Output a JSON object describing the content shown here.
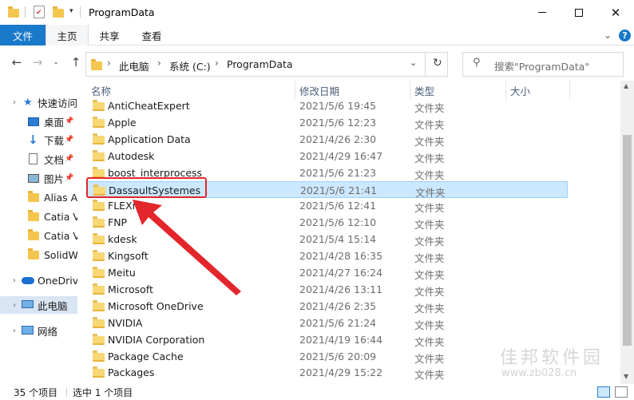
{
  "window": {
    "title": "ProgramData"
  },
  "ribbon": {
    "tabs": [
      {
        "label": "文件"
      },
      {
        "label": "主页"
      },
      {
        "label": "共享"
      },
      {
        "label": "查看"
      }
    ]
  },
  "address": {
    "crumbs": [
      "此电脑",
      "系统 (C:)",
      "ProgramData"
    ],
    "search_placeholder": "搜索\"ProgramData\""
  },
  "nav_pane": {
    "items": [
      {
        "label": "快速访问",
        "icon": "star-icon"
      },
      {
        "label": "桌面",
        "icon": "desktop-icon"
      },
      {
        "label": "下载",
        "icon": "download-icon"
      },
      {
        "label": "文档",
        "icon": "document-icon"
      },
      {
        "label": "图片",
        "icon": "pictures-icon"
      },
      {
        "label": "Alias A",
        "icon": "folder-icon"
      },
      {
        "label": "Catia V",
        "icon": "folder-icon"
      },
      {
        "label": "Catia V",
        "icon": "folder-icon"
      },
      {
        "label": "SolidW",
        "icon": "folder-icon"
      },
      {
        "label": "OneDriv",
        "icon": "cloud-icon"
      },
      {
        "label": "此电脑",
        "icon": "computer-icon"
      },
      {
        "label": "网络",
        "icon": "network-icon"
      }
    ]
  },
  "columns": {
    "name": "名称",
    "date": "修改日期",
    "type": "类型",
    "size": "大小"
  },
  "files": [
    {
      "name": "AntiCheatExpert",
      "date": "2021/5/6 19:45",
      "type": "文件夹"
    },
    {
      "name": "Apple",
      "date": "2021/5/6 12:23",
      "type": "文件夹"
    },
    {
      "name": "Application Data",
      "date": "2021/4/26 2:30",
      "type": "文件夹"
    },
    {
      "name": "Autodesk",
      "date": "2021/4/29 16:47",
      "type": "文件夹"
    },
    {
      "name": "boost_interprocess",
      "date": "2021/5/6 21:23",
      "type": "文件夹"
    },
    {
      "name": "DassaultSystemes",
      "date": "2021/5/6 21:41",
      "type": "文件夹"
    },
    {
      "name": "FLEXnet",
      "date": "2021/5/6 12:41",
      "type": "文件夹"
    },
    {
      "name": "FNP",
      "date": "2021/5/6 12:10",
      "type": "文件夹"
    },
    {
      "name": "kdesk",
      "date": "2021/5/4 15:14",
      "type": "文件夹"
    },
    {
      "name": "Kingsoft",
      "date": "2021/4/28 16:35",
      "type": "文件夹"
    },
    {
      "name": "Meitu",
      "date": "2021/4/27 16:24",
      "type": "文件夹"
    },
    {
      "name": "Microsoft",
      "date": "2021/4/26 13:11",
      "type": "文件夹"
    },
    {
      "name": "Microsoft OneDrive",
      "date": "2021/4/26 2:35",
      "type": "文件夹"
    },
    {
      "name": "NVIDIA",
      "date": "2021/5/6 21:24",
      "type": "文件夹"
    },
    {
      "name": "NVIDIA Corporation",
      "date": "2021/4/19 16:44",
      "type": "文件夹"
    },
    {
      "name": "Package Cache",
      "date": "2021/5/6 20:09",
      "type": "文件夹"
    },
    {
      "name": "Packages",
      "date": "2021/4/29 15:22",
      "type": "文件夹"
    }
  ],
  "status": {
    "count": "35 个项目",
    "selected": "选中 1 个项目"
  },
  "watermark": {
    "text": "佳邦软件园",
    "url": "www.zb028.cn"
  },
  "colors": {
    "accent": "#1979ca",
    "selection": "#cce8ff",
    "highlight": "#e3262b"
  }
}
